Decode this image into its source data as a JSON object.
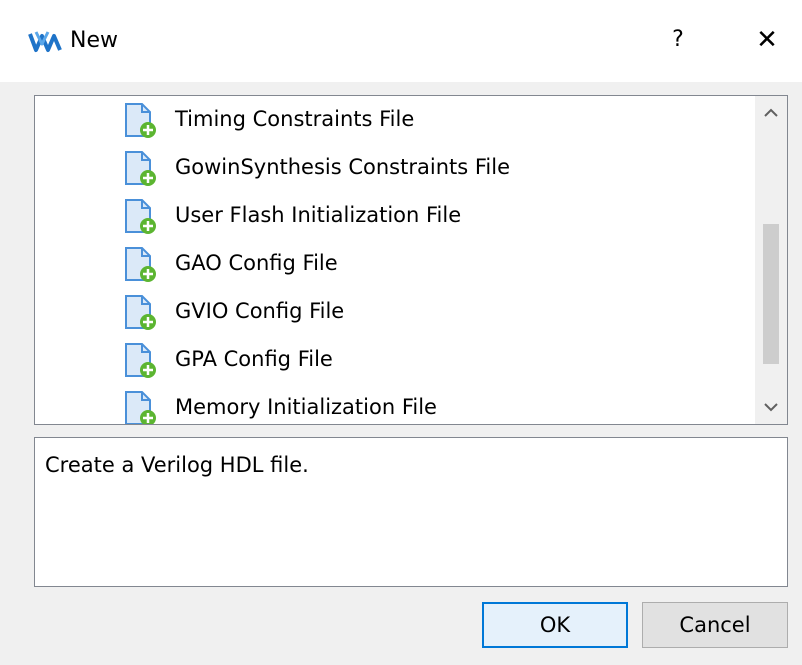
{
  "window": {
    "title": "New",
    "help_glyph": "?",
    "close_glyph": "✕",
    "icon": "gowin-logo-icon"
  },
  "file_list": {
    "items": [
      {
        "label": "Timing Constraints File",
        "icon": "new-file-icon"
      },
      {
        "label": "GowinSynthesis Constraints File",
        "icon": "new-file-icon"
      },
      {
        "label": "User Flash Initialization File",
        "icon": "new-file-icon"
      },
      {
        "label": "GAO Config File",
        "icon": "new-file-icon"
      },
      {
        "label": "GVIO Config File",
        "icon": "new-file-icon"
      },
      {
        "label": "GPA Config File",
        "icon": "new-file-icon"
      },
      {
        "label": "Memory Initialization File",
        "icon": "new-file-icon"
      }
    ]
  },
  "description": {
    "text": "Create a Verilog HDL file."
  },
  "buttons": {
    "ok_label": "OK",
    "cancel_label": "Cancel"
  },
  "colors": {
    "accent": "#0078d7",
    "file_badge": "#5cb531",
    "file_icon": "#4a90d9"
  }
}
